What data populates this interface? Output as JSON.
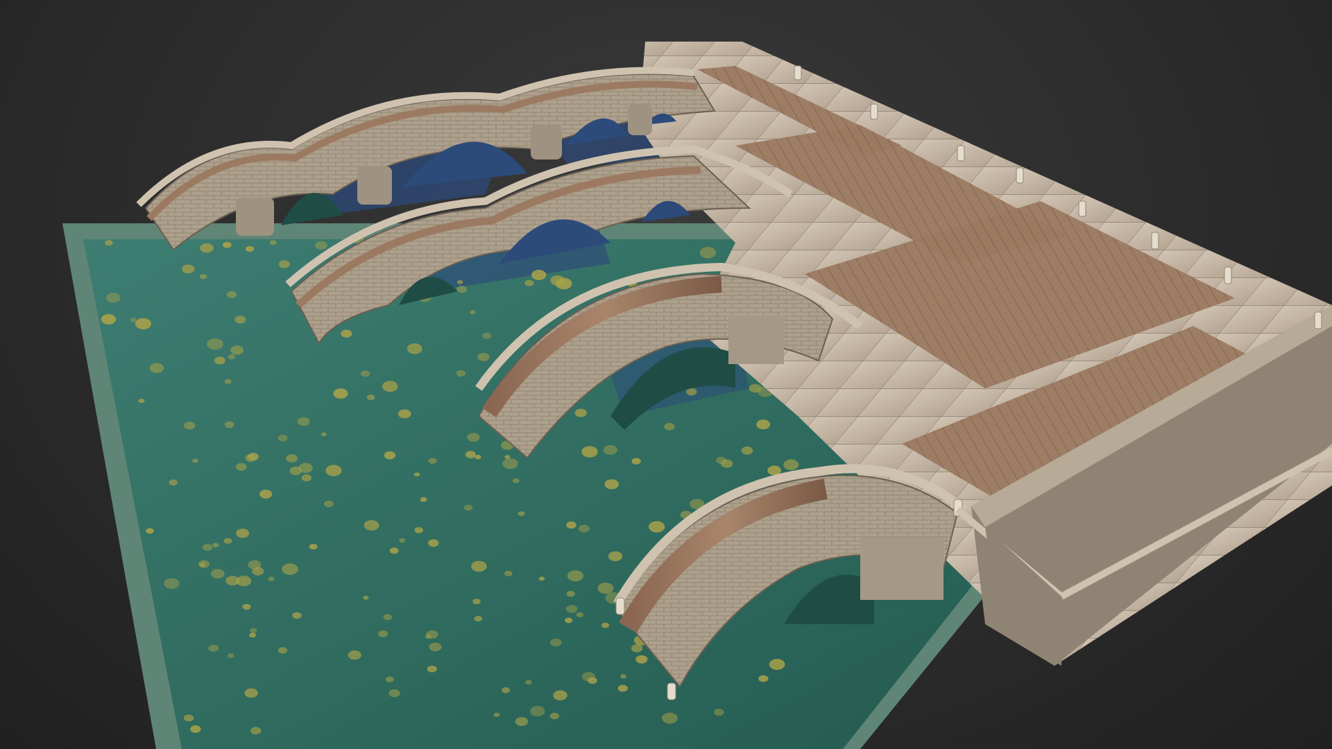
{
  "scene": {
    "subject": "",
    "background_color": "#2e2e2e",
    "colors": {
      "water": "#2f6b5e",
      "water_dark": "#1f4d46",
      "water_deep": "#2c4a7a",
      "water_edge": "#6f8f7e",
      "lily_pad": "#a8a14a",
      "stone": "#b7ab98",
      "stone_dark": "#8f8474",
      "stone_shadow": "#6a5f52",
      "paving": "#c7b8a6",
      "paving_line": "#7a6d60",
      "wood": "#9c7a62",
      "wood_dark": "#7a5a46",
      "rail": "#cfc3b0",
      "post_cap": "#e4dccd"
    },
    "bridges": [
      {
        "id": "bridge-four-arch",
        "arches": 4
      },
      {
        "id": "bridge-three-arch",
        "arches": 3
      },
      {
        "id": "bridge-single-arch-large",
        "arches": 1
      },
      {
        "id": "bridge-single-arch-front",
        "arches": 1
      }
    ],
    "dock": {
      "rows": 4,
      "wood_strips": 4
    }
  }
}
